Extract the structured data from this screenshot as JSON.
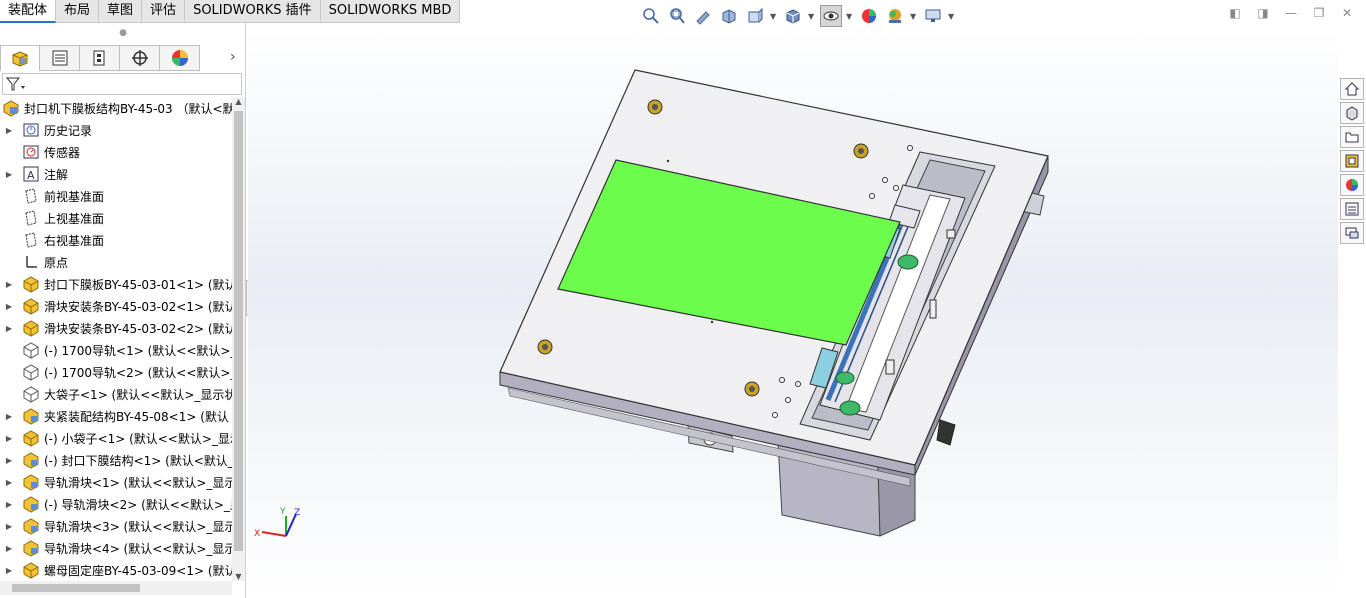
{
  "ribbon": {
    "tabs": [
      {
        "label": "装配体",
        "active": true
      },
      {
        "label": "布局"
      },
      {
        "label": "草图"
      },
      {
        "label": "评估"
      },
      {
        "label": "SOLIDWORKS 插件"
      },
      {
        "label": "SOLIDWORKS MBD"
      }
    ]
  },
  "view_toolbar": {
    "icons": [
      "zoom-to-fit-icon",
      "zoom-to-area-icon",
      "previous-view-icon",
      "section-view-icon",
      "view-orientation-icon",
      "display-style-icon",
      "hide-show-items-icon",
      "edit-appearance-icon",
      "apply-scene-icon",
      "view-settings-icon"
    ]
  },
  "feature_tree": {
    "tabs": [
      "featuremanager-tab",
      "propertymanager-tab",
      "configurationmanager-tab",
      "dimxpert-tab",
      "displaymanager-tab"
    ],
    "root": "封口机下膜板结构BY-45-03 （默认<默认",
    "items": [
      {
        "label": "历史记录",
        "icon": "history-icon",
        "expandable": true
      },
      {
        "label": "传感器",
        "icon": "sensor-icon",
        "expandable": false
      },
      {
        "label": "注解",
        "icon": "annotation-icon",
        "expandable": true
      },
      {
        "label": "前视基准面",
        "icon": "plane-icon",
        "expandable": false
      },
      {
        "label": "上视基准面",
        "icon": "plane-icon",
        "expandable": false
      },
      {
        "label": "右视基准面",
        "icon": "plane-icon",
        "expandable": false
      },
      {
        "label": "原点",
        "icon": "origin-icon",
        "expandable": false
      },
      {
        "label": "封口下膜板BY-45-03-01<1> (默认",
        "icon": "part-icon",
        "expandable": true
      },
      {
        "label": "滑块安装条BY-45-03-02<1> (默认",
        "icon": "part-icon",
        "expandable": true
      },
      {
        "label": "滑块安装条BY-45-03-02<2> (默认",
        "icon": "part-icon",
        "expandable": true
      },
      {
        "label": "(-) 1700导轨<1> (默认<<默认>_",
        "icon": "part-outline-icon",
        "expandable": false
      },
      {
        "label": "(-) 1700导轨<2> (默认<<默认>_",
        "icon": "part-outline-icon",
        "expandable": false
      },
      {
        "label": "大袋子<1> (默认<<默认>_显示状",
        "icon": "part-outline-icon",
        "expandable": false
      },
      {
        "label": "夹紧装配结构BY-45-08<1> (默认",
        "icon": "assembly-icon",
        "expandable": true
      },
      {
        "label": "(-) 小袋子<1> (默认<<默认>_显示",
        "icon": "part-icon",
        "expandable": true
      },
      {
        "label": "(-) 封口下膜结构<1> (默认<默认_",
        "icon": "assembly-icon",
        "expandable": true
      },
      {
        "label": "导轨滑块<1> (默认<<默认>_显示",
        "icon": "assembly-icon",
        "expandable": true
      },
      {
        "label": "(-) 导轨滑块<2> (默认<<默认>_显",
        "icon": "assembly-icon",
        "expandable": true
      },
      {
        "label": "导轨滑块<3> (默认<<默认>_显示",
        "icon": "assembly-icon",
        "expandable": true
      },
      {
        "label": "导轨滑块<4> (默认<<默认>_显示",
        "icon": "assembly-icon",
        "expandable": true
      },
      {
        "label": "螺母固定座BY-45-03-09<1> (默认",
        "icon": "part-icon",
        "expandable": true
      }
    ]
  },
  "task_pane": {
    "buttons": [
      "home-icon",
      "design-library-icon",
      "file-explorer-icon",
      "view-palette-icon",
      "appearances-icon",
      "custom-properties-icon",
      "forum-icon"
    ]
  },
  "triad": {
    "x": "X",
    "y": "Y",
    "z": "Z"
  },
  "colors": {
    "accent": "#2e6fd0",
    "bag_green": "#6dfd4d",
    "plate": "#ececf0",
    "part_yellow": "#e8c04a"
  }
}
